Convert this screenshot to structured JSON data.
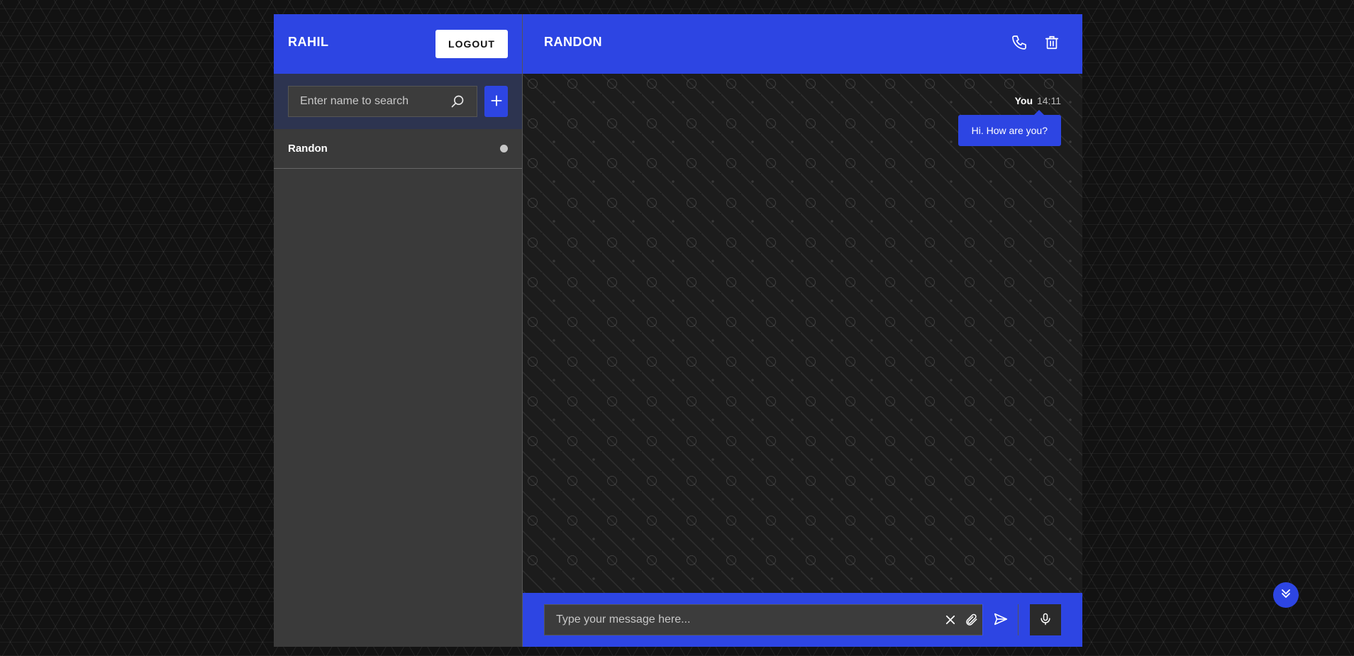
{
  "sidebar": {
    "user_name": "RAHIL",
    "logout_label": "LOGOUT",
    "search": {
      "placeholder": "Enter name to search"
    },
    "add_icon": "plus-icon",
    "contacts": [
      {
        "name": "Randon",
        "status": "offline"
      }
    ]
  },
  "chat": {
    "title": "RANDON",
    "header_icons": [
      "phone-icon",
      "trash-icon"
    ],
    "messages": [
      {
        "author": "You",
        "time": "14:11",
        "text": "Hi. How are you?"
      }
    ],
    "composer": {
      "placeholder": "Type your message here...",
      "icons": [
        "close-icon",
        "paperclip-icon",
        "send-icon",
        "microphone-icon"
      ]
    }
  },
  "scroll_icon": "double-chevron-down-icon",
  "colors": {
    "accent": "#2d45e3",
    "sidebar_bg": "#3a3a3a",
    "chat_bg": "#1c1c1c",
    "search_bar_bg": "#2d3450"
  }
}
